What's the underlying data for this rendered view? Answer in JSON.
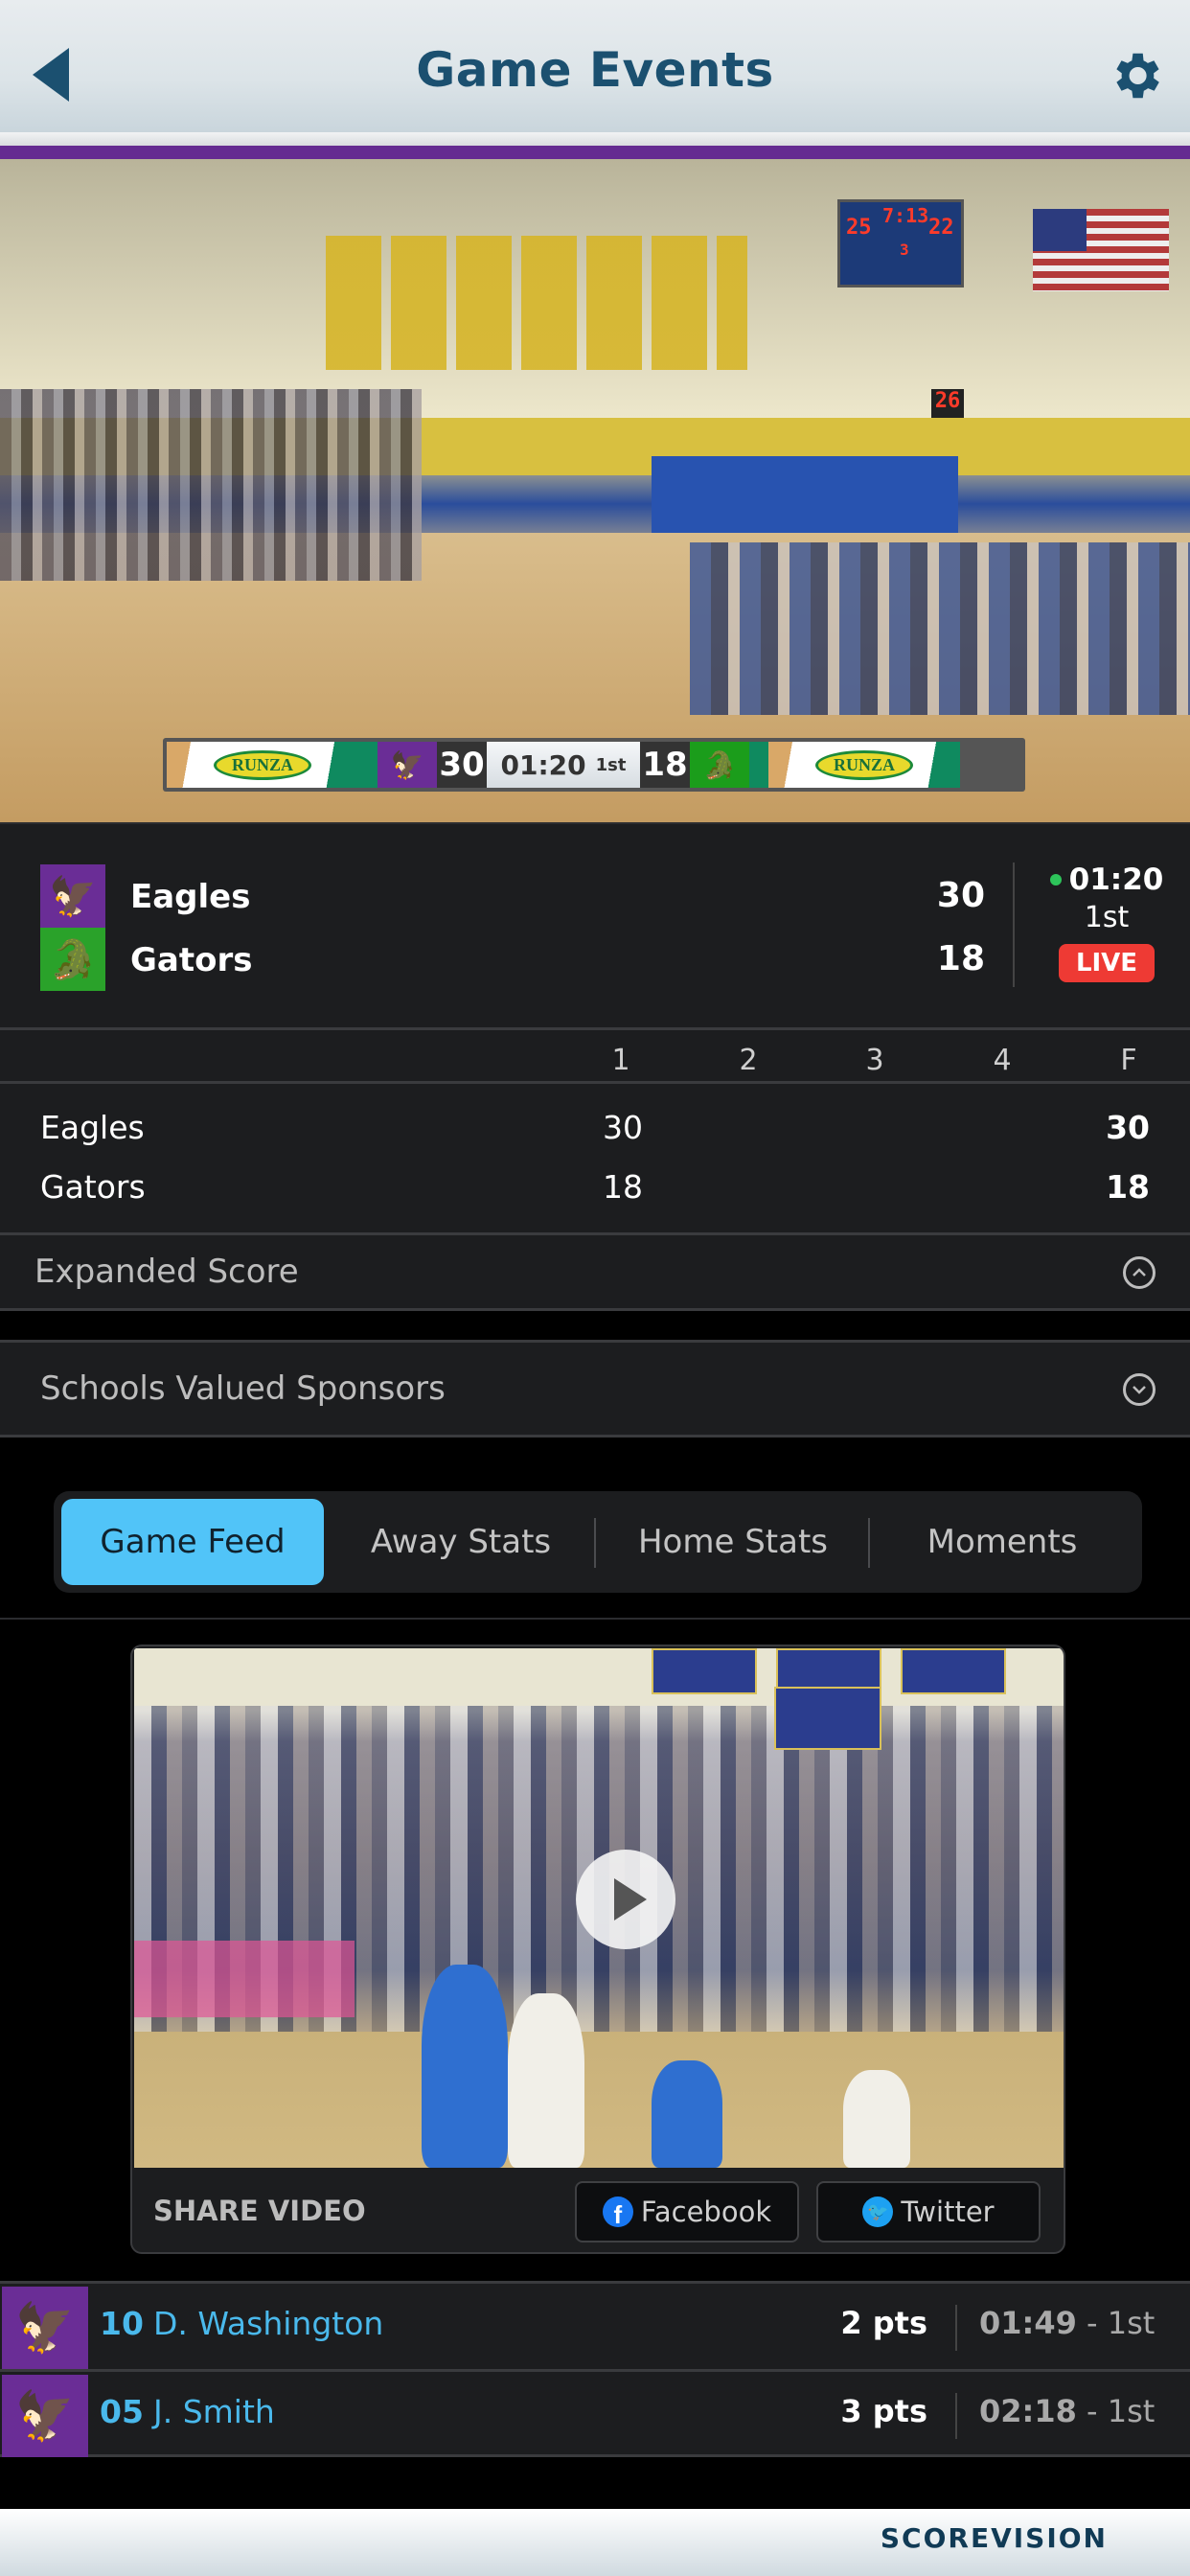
{
  "header": {
    "title": "Game Events",
    "back_icon": "back-triangle-icon",
    "settings_icon": "gear-icon"
  },
  "colors": {
    "header_text": "#1b5070",
    "home_accent": "#652b91",
    "away_accent": "#2aa22a",
    "tab_active": "#51c4f8",
    "live_badge": "#ee3a34",
    "player_link": "#4ab9ec",
    "live_dot": "#2dc45a"
  },
  "live_video": {
    "broadcast_bug": {
      "sponsor_left": "RUNZA",
      "home_score": "30",
      "clock": "01:20",
      "period": "1st",
      "away_score": "18",
      "sponsor_right": "RUNZA"
    },
    "gym_scoreboard": {
      "time": "7:13",
      "home": "25",
      "guests": "22",
      "period": "3",
      "shot_clock": "26"
    }
  },
  "summary": {
    "teams": [
      {
        "name": "Eagles",
        "score": "30",
        "logo": "eagle-logo-icon"
      },
      {
        "name": "Gators",
        "score": "18",
        "logo": "gator-logo-icon"
      }
    ],
    "clock": "01:20",
    "period": "1st",
    "status_badge": "LIVE"
  },
  "box_score": {
    "columns": [
      "1",
      "2",
      "3",
      "4",
      "F"
    ],
    "rows": [
      {
        "team": "Eagles",
        "q1": "30",
        "q2": "",
        "q3": "",
        "q4": "",
        "final": "30"
      },
      {
        "team": "Gators",
        "q1": "18",
        "q2": "",
        "q3": "",
        "q4": "",
        "final": "18"
      }
    ]
  },
  "sections": {
    "expanded_score": "Expanded Score",
    "sponsors": "Schools Valued Sponsors"
  },
  "tabs": [
    {
      "label": "Game Feed",
      "active": true
    },
    {
      "label": "Away Stats",
      "active": false
    },
    {
      "label": "Home Stats",
      "active": false
    },
    {
      "label": "Moments",
      "active": false
    }
  ],
  "video_card": {
    "share_label": "SHARE VIDEO",
    "facebook_label": "Facebook",
    "twitter_label": "Twitter"
  },
  "feed": [
    {
      "number": "10",
      "player": "D. Washington",
      "points": "2 pts",
      "time": "01:49",
      "period": "- 1st"
    },
    {
      "number": "05",
      "player": "J. Smith",
      "points": "3 pts",
      "time": "02:18",
      "period": "- 1st"
    }
  ],
  "footer": {
    "brand": "SCOREVISION"
  }
}
